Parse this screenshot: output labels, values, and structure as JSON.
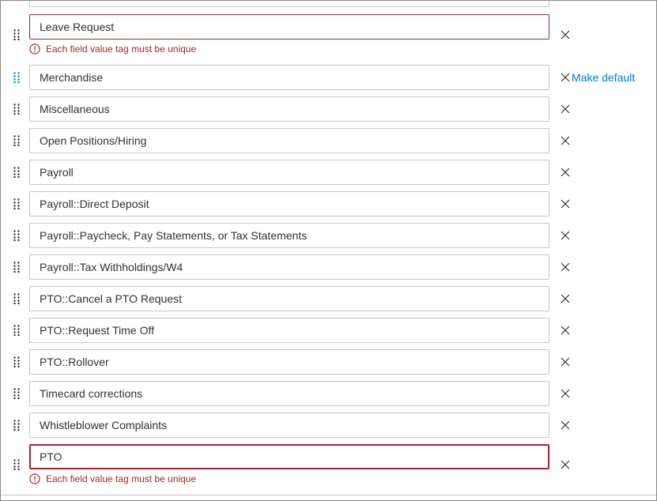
{
  "rows": [
    {
      "value": "Leave Request",
      "error": "Each field value tag must be unique"
    },
    {
      "value": "Merchandise",
      "make_default": "Make default"
    },
    {
      "value": "Miscellaneous"
    },
    {
      "value": "Open Positions/Hiring"
    },
    {
      "value": "Payroll"
    },
    {
      "value": "Payroll::Direct Deposit"
    },
    {
      "value": "Payroll::Paycheck, Pay Statements, or Tax Statements"
    },
    {
      "value": "Payroll::Tax Withholdings/W4"
    },
    {
      "value": "PTO::Cancel a PTO Request"
    },
    {
      "value": "PTO::Request Time Off"
    },
    {
      "value": "PTO::Rollover"
    },
    {
      "value": "Timecard corrections"
    },
    {
      "value": "Whistleblower Complaints"
    },
    {
      "value": "PTO",
      "error": "Each field value tag must be unique"
    }
  ],
  "colors": {
    "error": "#a4262c",
    "link": "#0078d4",
    "border": "#c8c6c4",
    "handle_active": "#0078d4"
  },
  "icons": {
    "drag": "drag-handle-icon",
    "remove": "close-icon",
    "error": "error-circle-icon"
  }
}
